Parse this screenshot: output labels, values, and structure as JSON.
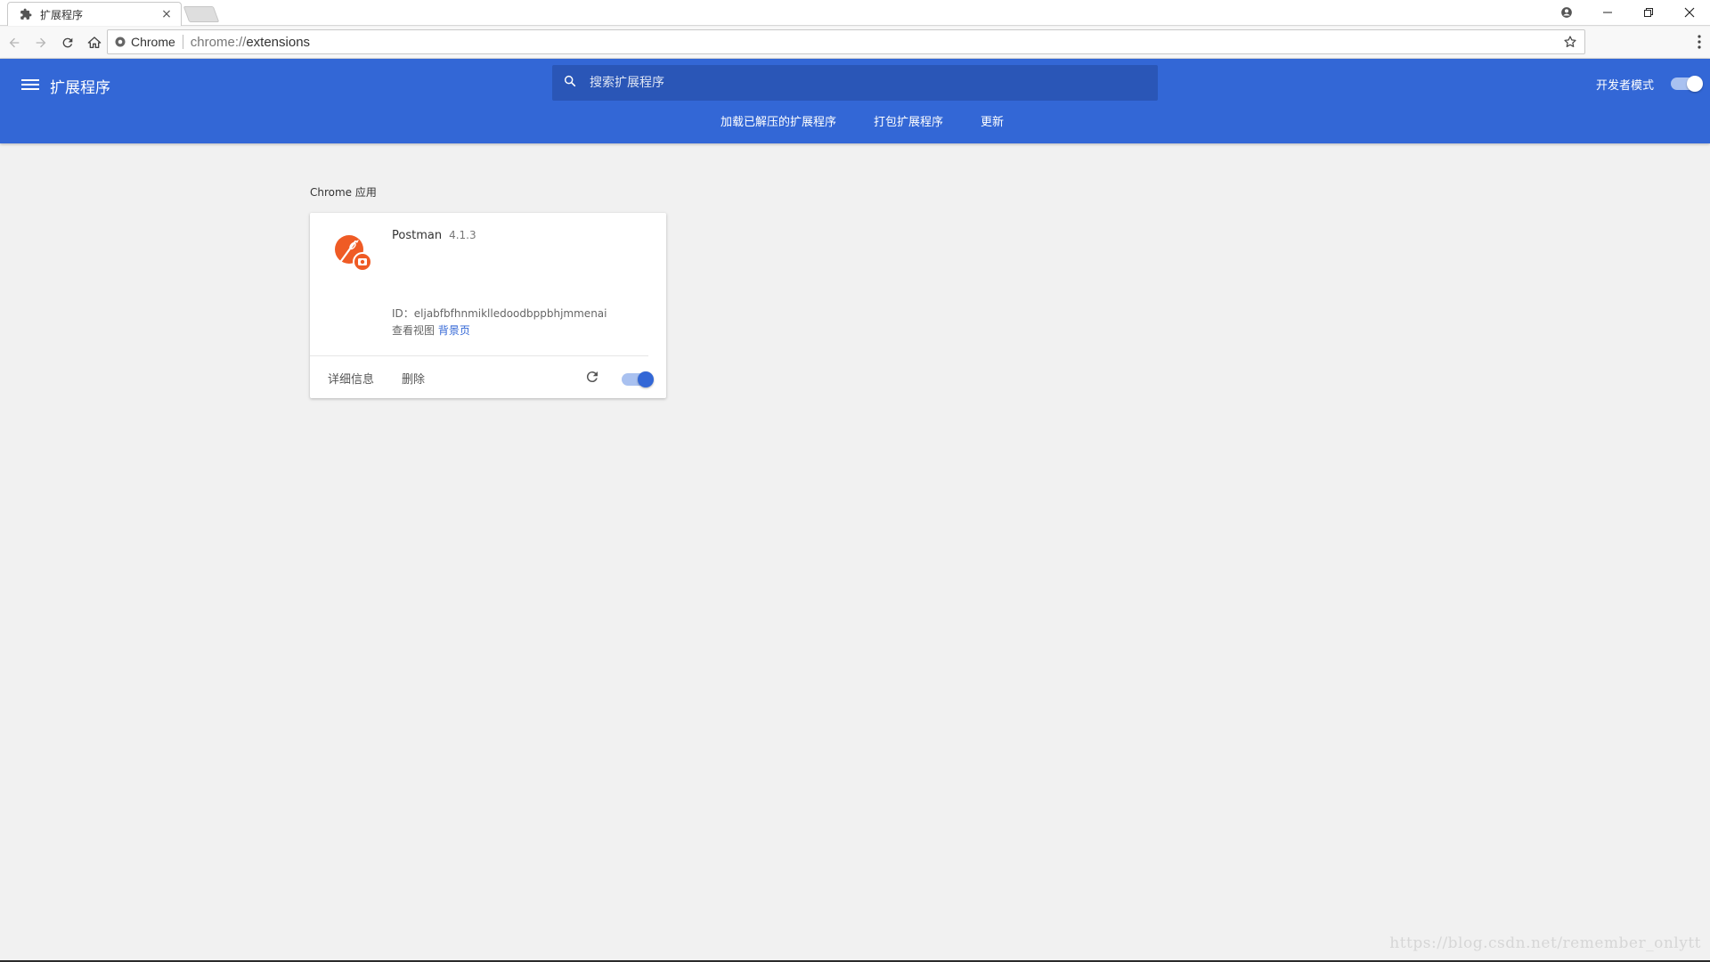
{
  "browser": {
    "tab_title": "扩展程序",
    "tab_close": "×",
    "secure_label": "Chrome",
    "url_scheme": "chrome://",
    "url_path": "extensions"
  },
  "header": {
    "title": "扩展程序",
    "search_placeholder": "搜索扩展程序",
    "dev_mode_label": "开发者模式",
    "dev_mode_on": true,
    "actions": [
      "加载已解压的扩展程序",
      "打包扩展程序",
      "更新"
    ]
  },
  "content": {
    "section_title": "Chrome 应用",
    "extension": {
      "name": "Postman",
      "version": "4.1.3",
      "id_line": "ID：eljabfbfhnmiklledoodbppbhjmmenai",
      "views_label": "查看视图",
      "views_link": "背景页",
      "details_label": "详细信息",
      "remove_label": "删除",
      "enabled": true
    }
  },
  "watermark": "https://blog.csdn.net/remember_onlytt",
  "colors": {
    "header_bg": "#3367d6",
    "search_bg": "#2a56b7",
    "page_bg": "#f1f1f1",
    "link": "#3367d6",
    "postman_orange": "#ef5b25"
  }
}
